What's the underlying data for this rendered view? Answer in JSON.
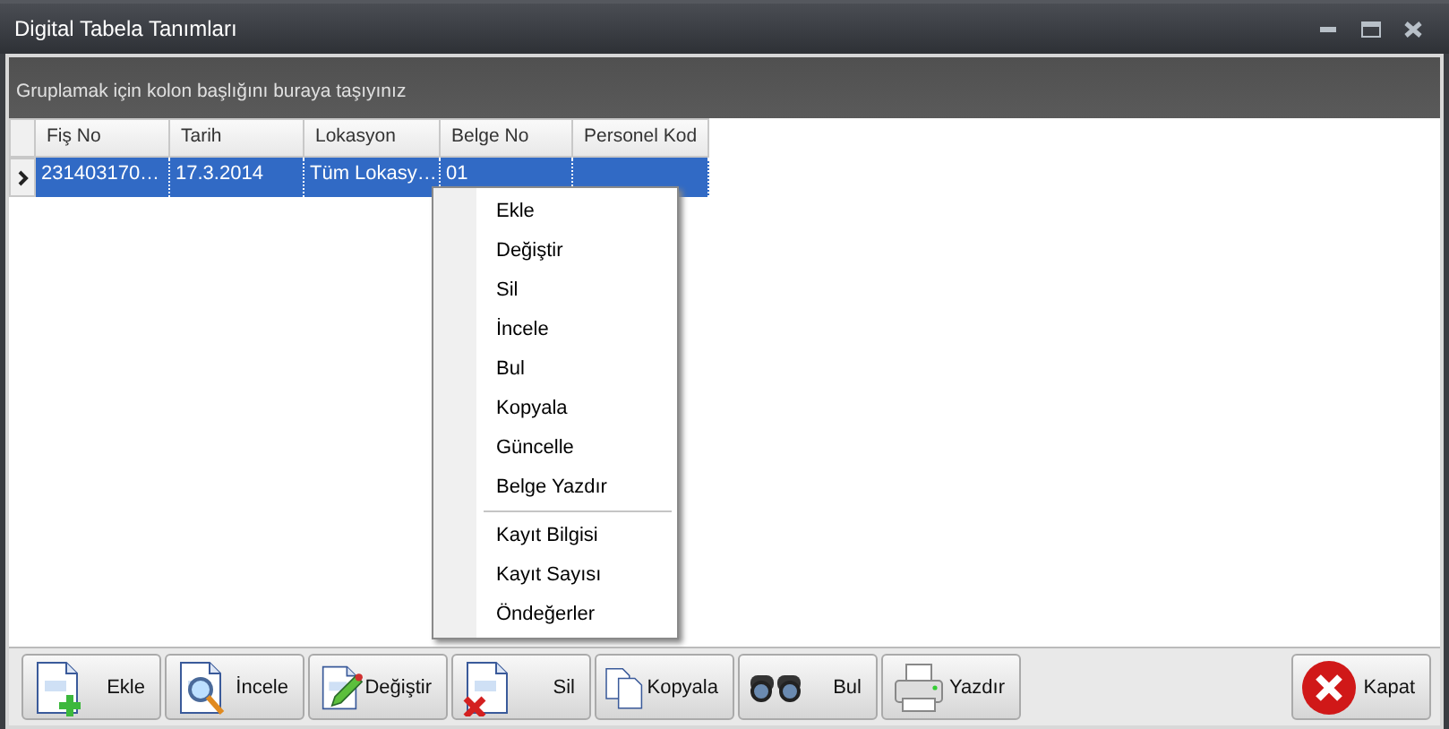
{
  "window": {
    "title": "Digital Tabela Tanımları"
  },
  "group_panel": {
    "hint": "Gruplamak için kolon başlığını buraya taşıyınız"
  },
  "table": {
    "columns": [
      "Fiş No",
      "Tarih",
      "Lokasyon",
      "Belge No",
      "Personel Kod"
    ],
    "rows": [
      {
        "selected": true,
        "cells": [
          "231403170…",
          "17.3.2014",
          "Tüm Lokasy…",
          "01",
          ""
        ]
      }
    ]
  },
  "context_menu": {
    "groups": [
      [
        "Ekle",
        "Değiştir",
        "Sil",
        "İncele",
        "Bul",
        "Kopyala",
        "Güncelle",
        "Belge Yazdır"
      ],
      [
        "Kayıt Bilgisi",
        "Kayıt Sayısı",
        "Öndeğerler"
      ]
    ]
  },
  "toolbar": {
    "buttons": [
      {
        "kind": "add",
        "label": "Ekle"
      },
      {
        "kind": "inspect",
        "label": "İncele"
      },
      {
        "kind": "edit",
        "label": "Değiştir"
      },
      {
        "kind": "delete",
        "label": "Sil"
      },
      {
        "kind": "copy",
        "label": "Kopyala"
      },
      {
        "kind": "find",
        "label": "Bul"
      },
      {
        "kind": "print",
        "label": "Yazdır"
      }
    ],
    "close_button": {
      "label": "Kapat"
    }
  }
}
